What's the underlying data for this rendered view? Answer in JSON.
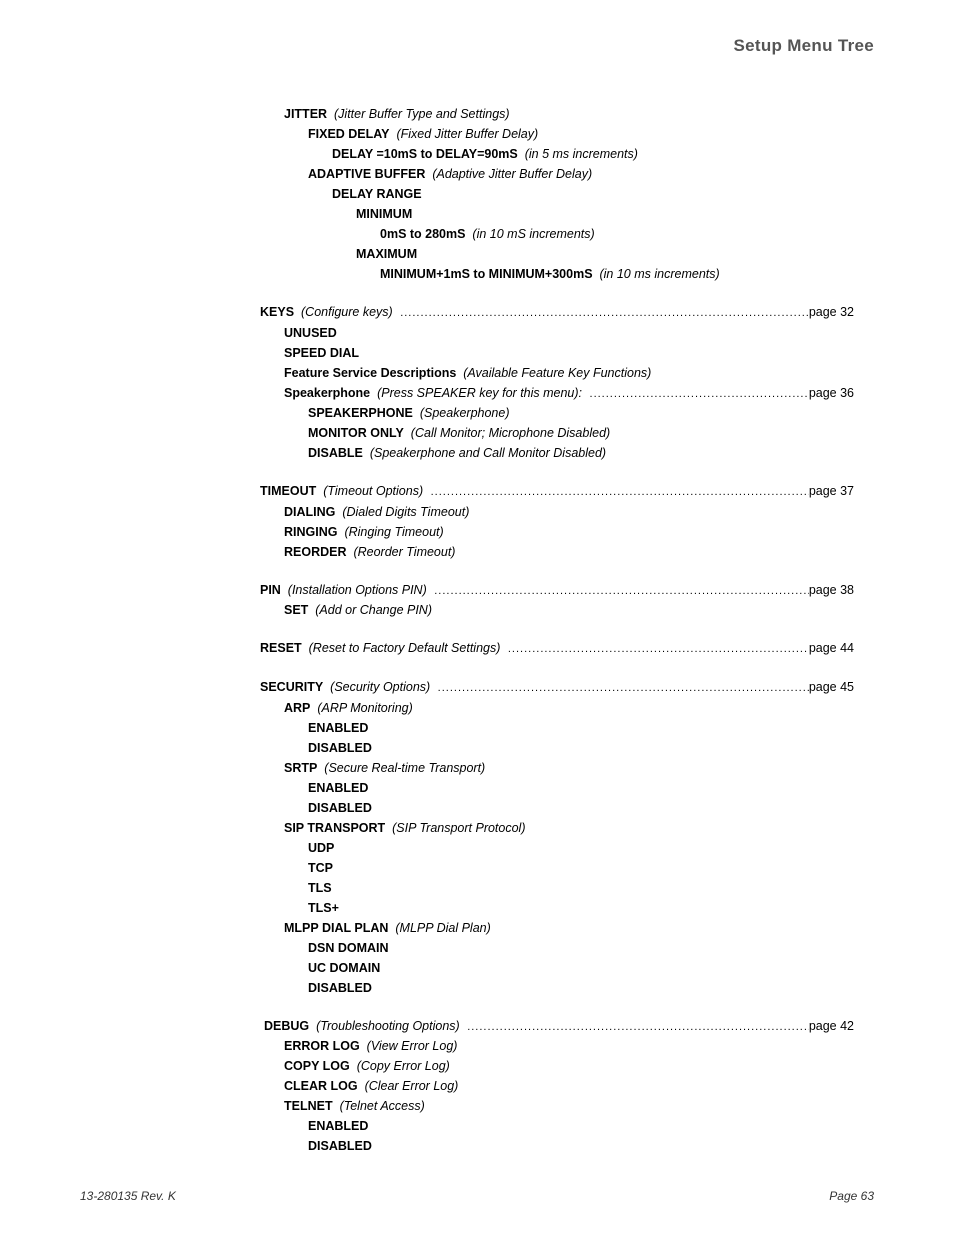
{
  "header": "Setup Menu Tree",
  "jitter": {
    "title": "JITTER",
    "desc": "(Jitter Buffer Type and Settings)",
    "fixed": {
      "title": "FIXED DELAY",
      "desc": "(Fixed Jitter Buffer Delay)"
    },
    "fixed_range": {
      "title": "DELAY =10mS to DELAY=90mS",
      "desc": "(in 5 ms increments)"
    },
    "adaptive": {
      "title": "ADAPTIVE BUFFER",
      "desc": "(Adaptive Jitter Buffer Delay)"
    },
    "delay_range": "DELAY RANGE",
    "minimum": "MINIMUM",
    "min_range": {
      "title": "0mS to 280mS",
      "desc": "(in 10 mS increments)"
    },
    "maximum": "MAXIMUM",
    "max_range": {
      "title": "MINIMUM+1mS to MINIMUM+300mS",
      "desc": "(in 10 ms increments)"
    }
  },
  "keys": {
    "title": "KEYS",
    "desc": "(Configure keys)",
    "page": "page 32",
    "unused": "UNUSED",
    "speeddial": "SPEED DIAL",
    "feature": {
      "title": "Feature Service Descriptions",
      "desc": "(Available Feature Key Functions)"
    },
    "speaker": {
      "title": "Speakerphone",
      "desc": "(Press SPEAKER key for this menu):",
      "page": "page 36"
    },
    "sp1": {
      "title": "SPEAKERPHONE",
      "desc": "(Speakerphone)"
    },
    "sp2": {
      "title": "MONITOR ONLY",
      "desc": "(Call Monitor; Microphone Disabled)"
    },
    "sp3": {
      "title": "DISABLE",
      "desc": "(Speakerphone and Call Monitor Disabled)"
    }
  },
  "timeout": {
    "title": "TIMEOUT",
    "desc": "(Timeout Options)",
    "page": "page 37",
    "dialing": {
      "title": "DIALING",
      "desc": "(Dialed Digits Timeout)"
    },
    "ringing": {
      "title": "RINGING",
      "desc": "(Ringing Timeout)"
    },
    "reorder": {
      "title": "REORDER",
      "desc": "(Reorder Timeout)"
    }
  },
  "pin": {
    "title": "PIN",
    "desc": "(Installation Options PIN)",
    "page": "page 38",
    "set": {
      "title": "SET",
      "desc": "(Add or Change PIN)"
    }
  },
  "reset": {
    "title": "RESET",
    "desc": "(Reset to Factory Default Settings)",
    "page": "page 44"
  },
  "security": {
    "title": "SECURITY",
    "desc": "(Security Options)",
    "page": "page 45",
    "arp": {
      "title": "ARP",
      "desc": "(ARP Monitoring)"
    },
    "enabled": "ENABLED",
    "disabled": "DISABLED",
    "srtp": {
      "title": "SRTP",
      "desc": "(Secure Real-time Transport)"
    },
    "sip": {
      "title": "SIP TRANSPORT",
      "desc": "(SIP Transport Protocol)"
    },
    "udp": "UDP",
    "tcp": "TCP",
    "tls": "TLS",
    "tlsp": "TLS+",
    "mlpp": {
      "title": "MLPP DIAL PLAN",
      "desc": "(MLPP Dial Plan)"
    },
    "dsn": "DSN DOMAIN",
    "uc": "UC DOMAIN"
  },
  "debug": {
    "title": "DEBUG",
    "desc": "(Troubleshooting Options)",
    "page": "page 42",
    "errorlog": {
      "title": "ERROR LOG",
      "desc": "(View Error Log)"
    },
    "copylog": {
      "title": "COPY LOG",
      "desc": "(Copy Error Log)"
    },
    "clearlog": {
      "title": "CLEAR LOG",
      "desc": "(Clear Error Log)"
    },
    "telnet": {
      "title": "TELNET",
      "desc": "(Telnet Access)"
    }
  },
  "footer": {
    "left": "13-280135  Rev. K",
    "right": "Page 63"
  }
}
